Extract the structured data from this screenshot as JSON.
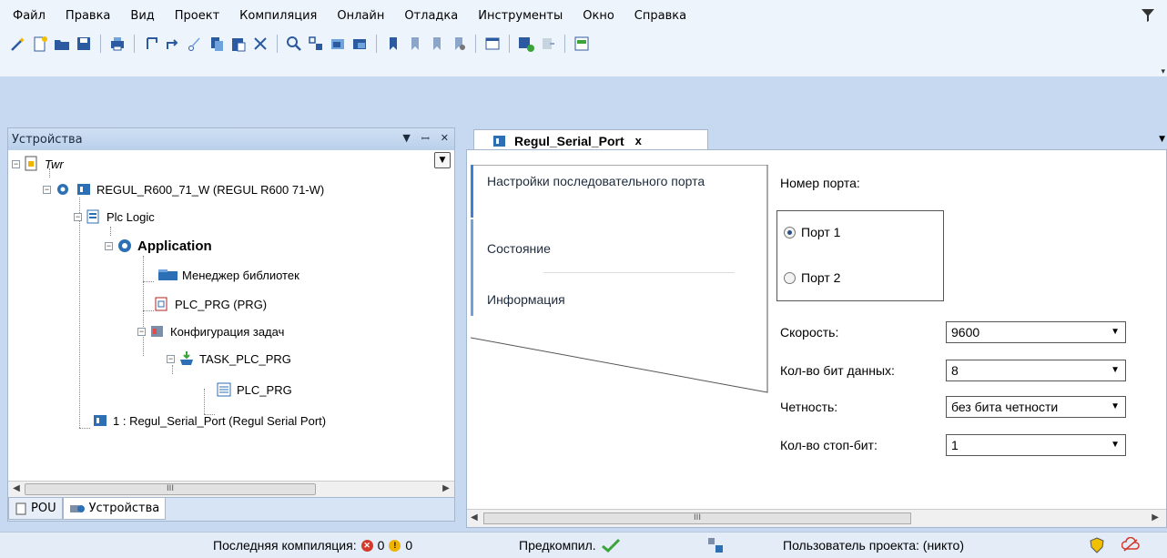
{
  "menu": {
    "items": [
      "Файл",
      "Правка",
      "Вид",
      "Проект",
      "Компиляция",
      "Онлайн",
      "Отладка",
      "Инструменты",
      "Окно",
      "Справка"
    ]
  },
  "toolbar": {
    "icons": [
      "wand-icon",
      "new-file-icon",
      "open-folder-icon",
      "save-icon",
      "print-icon",
      "undo-icon",
      "redo-icon",
      "cut-icon",
      "copy-icon",
      "paste-icon",
      "delete-icon",
      "find-icon",
      "replace-icon",
      "find-next-icon",
      "find-prev-icon",
      "bookmark-icon",
      "bookmark-next-icon",
      "bookmark-prev-icon",
      "bookmark-clear-icon",
      "window-icon",
      "add-device-icon",
      "import-icon",
      "device-config-icon"
    ]
  },
  "devices_panel": {
    "title": "Устройства",
    "tree": {
      "root": "Twr",
      "device": "REGUL_R600_71_W (REGUL R600 71-W)",
      "plc_logic": "Plc Logic",
      "application": "Application",
      "library_manager": "Менеджер библиотек",
      "plc_prg": "PLC_PRG (PRG)",
      "task_config": "Конфигурация задач",
      "task": "TASK_PLC_PRG",
      "task_prg": "PLC_PRG",
      "serial_port": "1 : Regul_Serial_Port (Regul Serial Port)"
    },
    "bottom_tabs": {
      "pou": "POU",
      "devices": "Устройства"
    },
    "scroll_thumb": "III"
  },
  "editor": {
    "tab_label": "Regul_Serial_Port",
    "close_glyph": "x",
    "vertical_tabs": {
      "serial_settings": "Настройки последовательного порта",
      "status": "Состояние",
      "info": "Информация"
    },
    "port_number_label": "Номер порта:",
    "port1": "Порт 1",
    "port2": "Порт 2",
    "port_selected": 1,
    "speed_label": "Скорость:",
    "speed_value": "9600",
    "data_bits_label": "Кол-во бит данных:",
    "data_bits_value": "8",
    "parity_label": "Четность:",
    "parity_value": "без бита четности",
    "stop_bits_label": "Кол-во стоп-бит:",
    "stop_bits_value": "1",
    "scroll_thumb": "III"
  },
  "status_bar": {
    "last_compile_label": "Последняя компиляция:",
    "errors": "0",
    "warnings": "0",
    "precompile_label": "Предкомпил.",
    "project_user": "Пользователь проекта: (никто)"
  },
  "colors": {
    "accent": "#6fa3dd",
    "background": "#c7d9f0",
    "error": "#d33a2c",
    "warning": "#f0b400",
    "ok": "#3aa33a"
  }
}
